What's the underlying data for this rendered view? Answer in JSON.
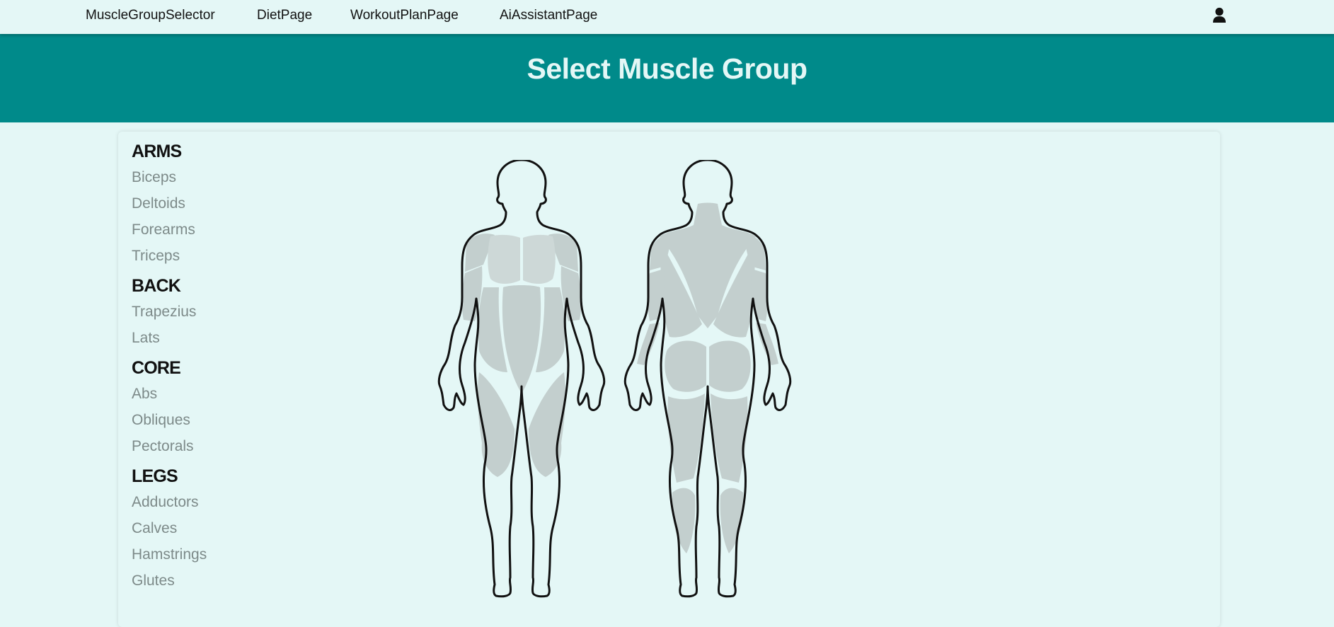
{
  "nav": {
    "links": [
      "MuscleGroupSelector",
      "DietPage",
      "WorkoutPlanPage",
      "AiAssistantPage"
    ],
    "user_icon": "user-icon"
  },
  "header": {
    "title": "Select Muscle Group"
  },
  "muscle_groups": [
    {
      "name": "ARMS",
      "muscles": [
        "Biceps",
        "Deltoids",
        "Forearms",
        "Triceps"
      ]
    },
    {
      "name": "BACK",
      "muscles": [
        "Trapezius",
        "Lats"
      ]
    },
    {
      "name": "CORE",
      "muscles": [
        "Abs",
        "Obliques",
        "Pectorals"
      ]
    },
    {
      "name": "LEGS",
      "muscles": [
        "Adductors",
        "Calves",
        "Hamstrings",
        "Glutes"
      ]
    }
  ],
  "colors": {
    "page_bg": "#e4f7f6",
    "banner": "#008a8a",
    "title": "#e4f7f6",
    "muscle_fill": "#c3cfce",
    "muscle_item": "#7d8a89"
  }
}
